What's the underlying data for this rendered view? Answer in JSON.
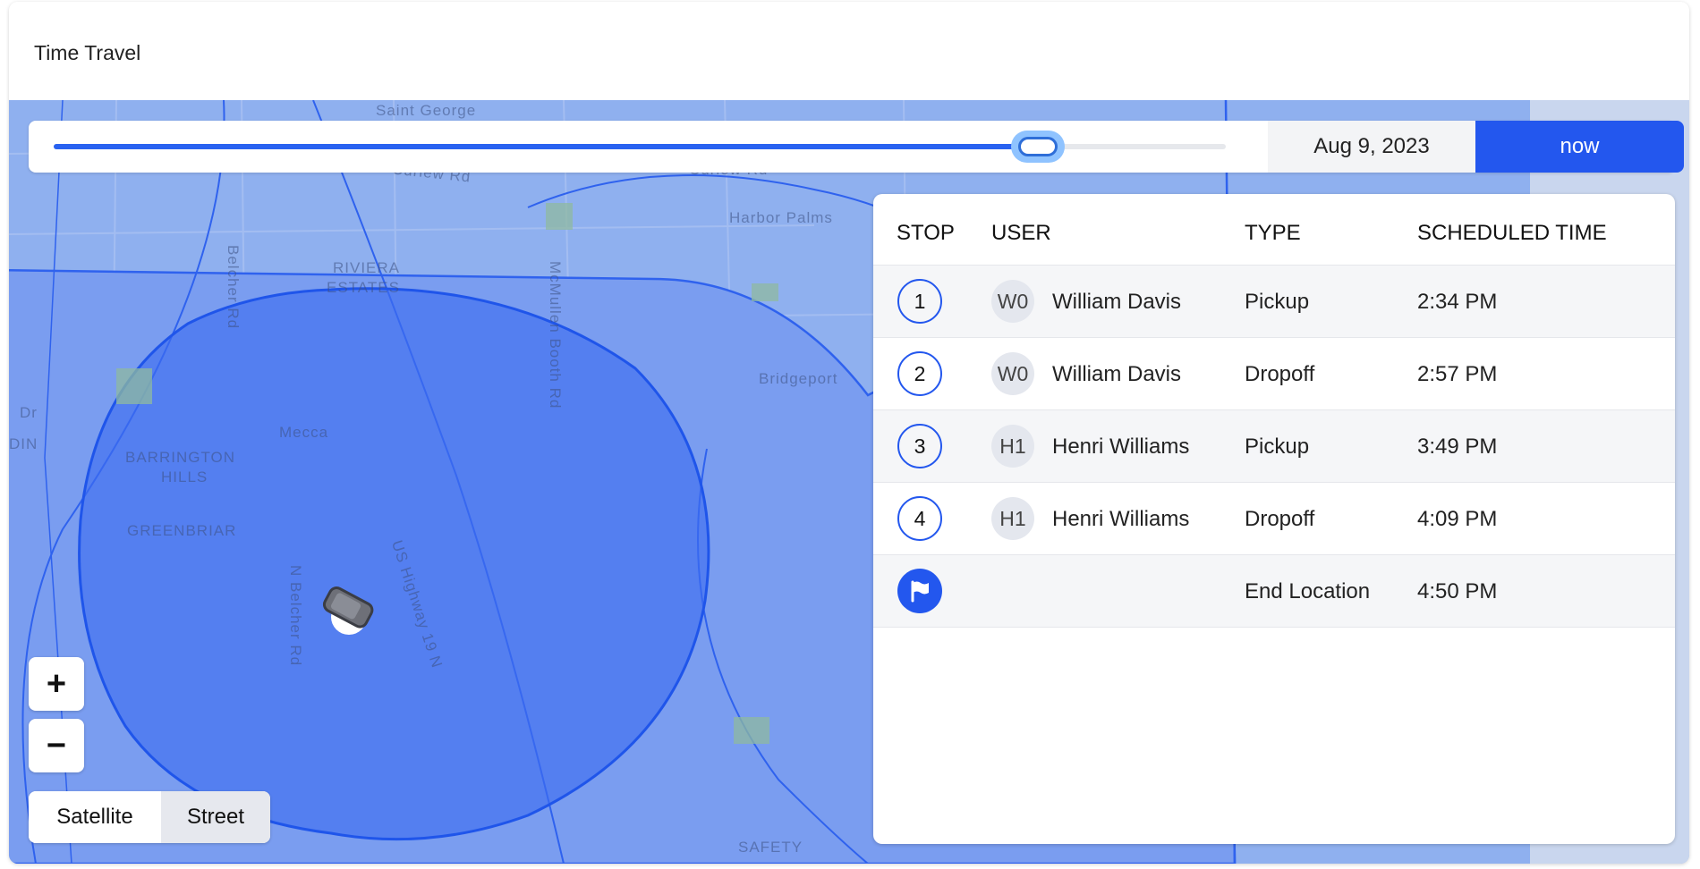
{
  "header": {
    "title": "Time Travel"
  },
  "slider": {
    "date": "Aug 9, 2023",
    "now_label": "now",
    "progress": 0.84
  },
  "table": {
    "columns": [
      "STOP",
      "USER",
      "TYPE",
      "SCHEDULED TIME"
    ],
    "rows": [
      {
        "stop": "1",
        "initials": "W0",
        "user": "William Davis",
        "type": "Pickup",
        "time": "2:34 PM"
      },
      {
        "stop": "2",
        "initials": "W0",
        "user": "William Davis",
        "type": "Dropoff",
        "time": "2:57 PM"
      },
      {
        "stop": "3",
        "initials": "H1",
        "user": "Henri Williams",
        "type": "Pickup",
        "time": "3:49 PM"
      },
      {
        "stop": "4",
        "initials": "H1",
        "user": "Henri Williams",
        "type": "Dropoff",
        "time": "4:09 PM"
      },
      {
        "stop_icon": "flag-icon",
        "type": "End Location",
        "time": "4:50 PM"
      }
    ]
  },
  "map": {
    "zoom_in": "+",
    "zoom_out": "−",
    "map_types": [
      "Satellite",
      "Street"
    ],
    "selected_map_type": "Street",
    "labels": [
      "Saint George",
      "Curlew Rd",
      "Curlew Rd",
      "Harbor Palms",
      "McMullen Booth Rd",
      "Belcher Rd",
      "RIVIERA",
      "ESTATES",
      "Bridgeport",
      "Mecca",
      "BARRINGTON",
      "HILLS",
      "GREENBRIAR",
      "N Belcher Rd",
      "US Highway 19 N",
      "SAFETY",
      "Dr",
      "DIN"
    ],
    "vehicle_icon": "car-icon"
  },
  "colors": {
    "accent": "#2357ee",
    "map_base": "#8fb0ef",
    "zone": "#3d6cf0"
  }
}
